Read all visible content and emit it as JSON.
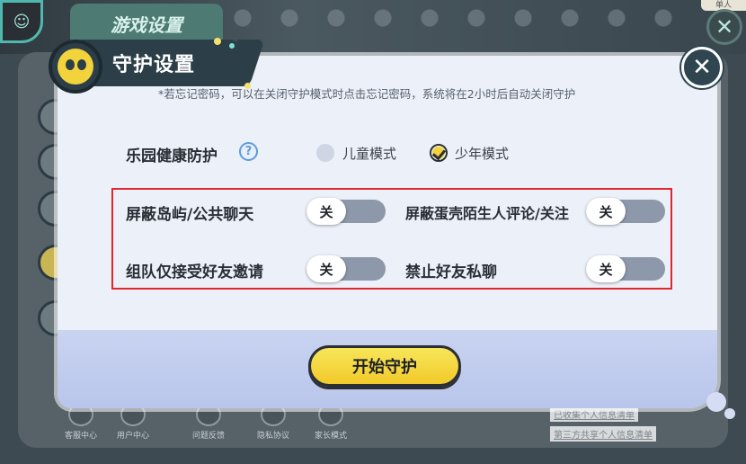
{
  "background": {
    "title": "游戏设置",
    "top_right_tag": "单人",
    "bottom_nav": [
      {
        "label": "客服中心"
      },
      {
        "label": "用户中心"
      },
      {
        "label": "问题反馈"
      },
      {
        "label": "隐私协议"
      },
      {
        "label": "家长模式"
      }
    ],
    "links": [
      "已收集个人信息清单",
      "第三方共享个人信息清单"
    ]
  },
  "dialog": {
    "title": "守护设置",
    "notice": "*若忘记密码，可以在关闭守护模式时点击忘记密码，系统将在2小时后自动关闭守护",
    "health": {
      "label": "乐园健康防护",
      "help": "?",
      "options": [
        {
          "label": "儿童模式",
          "selected": false
        },
        {
          "label": "少年模式",
          "selected": true
        }
      ]
    },
    "toggles": [
      {
        "label": "屏蔽岛屿/公共聊天",
        "state": "关"
      },
      {
        "label": "屏蔽蛋壳陌生人评论/关注",
        "state": "关"
      },
      {
        "label": "组队仅接受好友邀请",
        "state": "关"
      },
      {
        "label": "禁止好友私聊",
        "state": "关"
      }
    ],
    "start_button": "开始守护"
  },
  "colors": {
    "accent_yellow": "#f2d33b",
    "header_dark": "#2c3e48",
    "highlight_red": "#e0262f",
    "toggle_off": "#8d98ab"
  }
}
